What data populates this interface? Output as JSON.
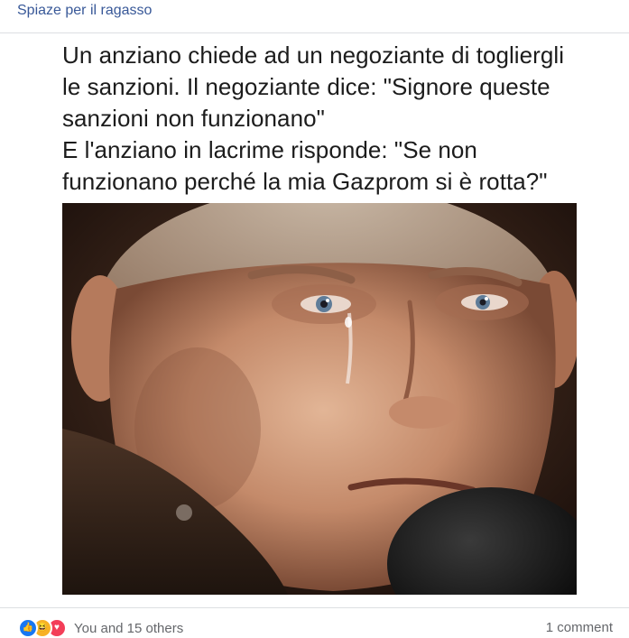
{
  "header": {
    "group_name": "Spiaze per il ragasso"
  },
  "post": {
    "text_lines": [
      "Un anziano chiede ad un negoziante di togliergli",
      "le sanzioni. Il negoziante dice: \"Signore queste",
      "sanzioni non funzionano\"",
      "E l'anziano in lacrime risponde: \"Se non",
      "funzionano perché la mia Gazprom si è rotta?\""
    ]
  },
  "footer": {
    "reaction_icons": [
      "like-icon",
      "haha-icon",
      "love-icon"
    ],
    "reactions_text": "You and 15 others",
    "comments_text": "1 comment"
  },
  "colors": {
    "link": "#385898",
    "like": "#1877f2",
    "haha": "#f7b125",
    "love": "#f33e58",
    "meta_text": "#65676b"
  }
}
